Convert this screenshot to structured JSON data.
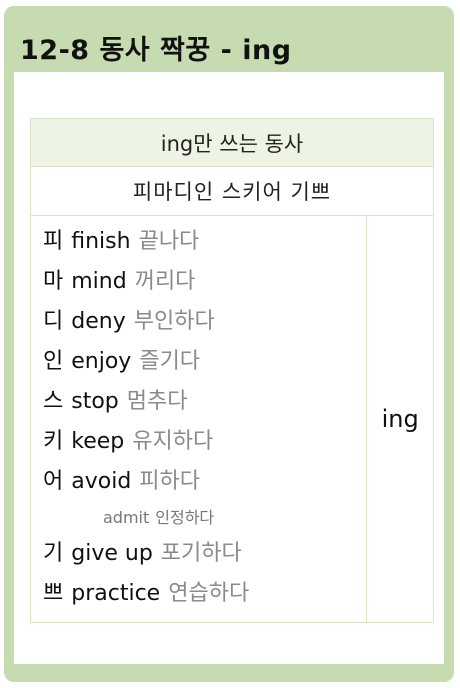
{
  "title": "12-8  동사 짝꿍 - ing",
  "table": {
    "header": "ing만 쓰는 동사",
    "mnemonic": "피마디인 스키어 기쁘",
    "result": "ing",
    "items": [
      {
        "key": "피",
        "en": "finish",
        "ko": "끝나다"
      },
      {
        "key": "마",
        "en": "mind",
        "ko": "꺼리다"
      },
      {
        "key": "디",
        "en": "deny",
        "ko": "부인하다"
      },
      {
        "key": "인",
        "en": "enjoy",
        "ko": "즐기다"
      },
      {
        "key": "스",
        "en": "stop",
        "ko": "멈추다"
      },
      {
        "key": "키",
        "en": "keep",
        "ko": "유지하다"
      },
      {
        "key": "어",
        "en": "avoid",
        "ko": "피하다"
      }
    ],
    "sub_item": {
      "en": "admit",
      "ko": "인정하다"
    },
    "items2": [
      {
        "key": "기",
        "en": "give up",
        "ko": "포기하다"
      },
      {
        "key": "쁘",
        "en": "practice",
        "ko": "연습하다"
      }
    ]
  },
  "colors": {
    "card": "#c7dbb0",
    "header_bg": "#eef4e4",
    "muted": "#8a8a8a"
  }
}
